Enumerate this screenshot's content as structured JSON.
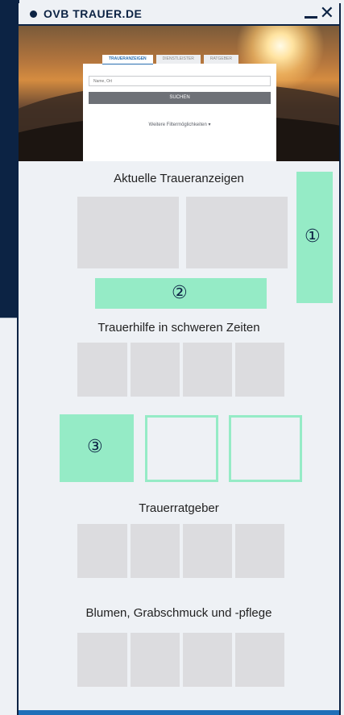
{
  "window": {
    "title": "OVB TRAUER.DE"
  },
  "search": {
    "tabs": [
      "TRAUERANZEIGEN",
      "DIENSTLEISTER",
      "RATGEBER"
    ],
    "placeholder": "Name, Ort",
    "button_label": "SUCHEN",
    "filters_label": "Weitere Filtermöglichkeiten ▾"
  },
  "sections": {
    "obituaries": "Aktuelle Traueranzeigen",
    "help": "Trauerhilfe in schweren Zeiten",
    "guide": "Trauerratgeber",
    "flowers": "Blumen, Grabschmuck und -pflege"
  },
  "markers": {
    "m1": "①",
    "m2": "②",
    "m3": "③"
  },
  "colors": {
    "accent_green": "#95ebc6",
    "navy": "#0c2344",
    "placeholder_gray": "#dcdcdf",
    "brand_blue": "#1f6fb8"
  }
}
